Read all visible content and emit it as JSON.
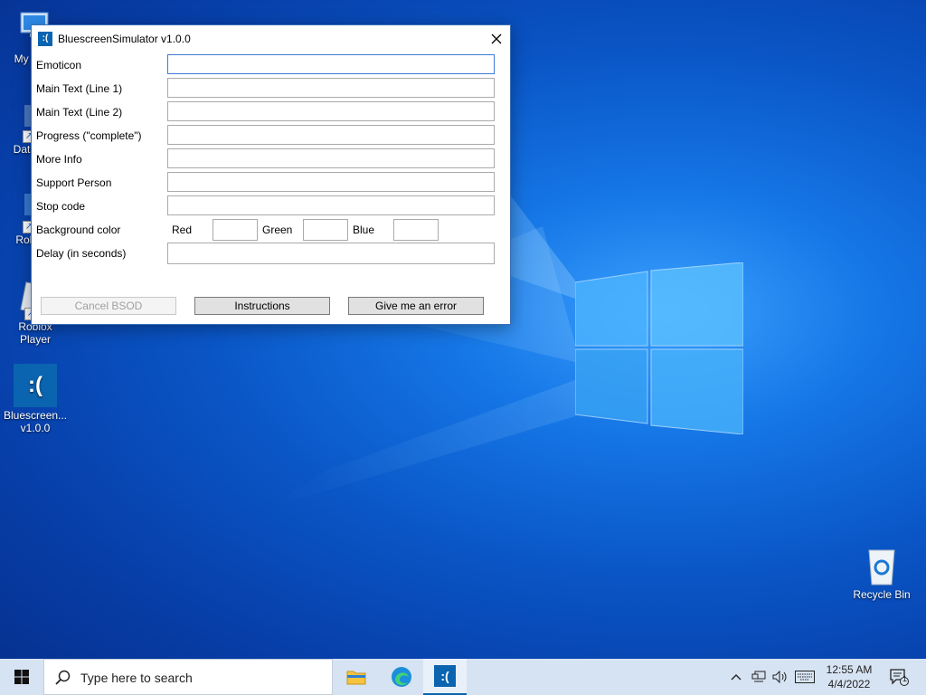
{
  "window": {
    "title": "BluescreenSimulator v1.0.0",
    "app_icon_glyph": ":(",
    "fields": [
      {
        "label": "Emoticon",
        "value": ""
      },
      {
        "label": "Main Text (Line 1)",
        "value": ""
      },
      {
        "label": "Main Text (Line 2)",
        "value": ""
      },
      {
        "label": "Progress (\"complete\")",
        "value": ""
      },
      {
        "label": "More Info",
        "value": ""
      },
      {
        "label": "Support Person",
        "value": ""
      },
      {
        "label": "Stop code",
        "value": ""
      }
    ],
    "background_color": {
      "label": "Background color",
      "red_label": "Red",
      "red_value": "",
      "green_label": "Green",
      "green_value": "",
      "blue_label": "Blue",
      "blue_value": ""
    },
    "delay": {
      "label": "Delay (in seconds)",
      "value": ""
    },
    "buttons": {
      "cancel": "Cancel BSOD",
      "instructions": "Instructions",
      "error": "Give me an error"
    }
  },
  "desktop_icons": [
    {
      "label": "My Co",
      "icon": "computer-icon"
    },
    {
      "label": "DataW",
      "icon": "app-shortcut-icon"
    },
    {
      "label": "Roblo",
      "icon": "roblox-studio-icon"
    },
    {
      "label": "Roblox Player",
      "icon": "roblox-player-icon"
    },
    {
      "label": "Bluescreen... v1.0.0",
      "icon": "bluescreen-app-icon"
    },
    {
      "label": "Recycle Bin",
      "icon": "recycle-bin-icon"
    }
  ],
  "bluescreen_icon_glyph": ":(",
  "taskbar": {
    "search_placeholder": "Type here to search",
    "time": "12:55 AM",
    "date": "4/4/2022",
    "notification_count": "1"
  },
  "colors": {
    "accent": "#0b64b0",
    "taskbar": "#d6e3f2"
  }
}
